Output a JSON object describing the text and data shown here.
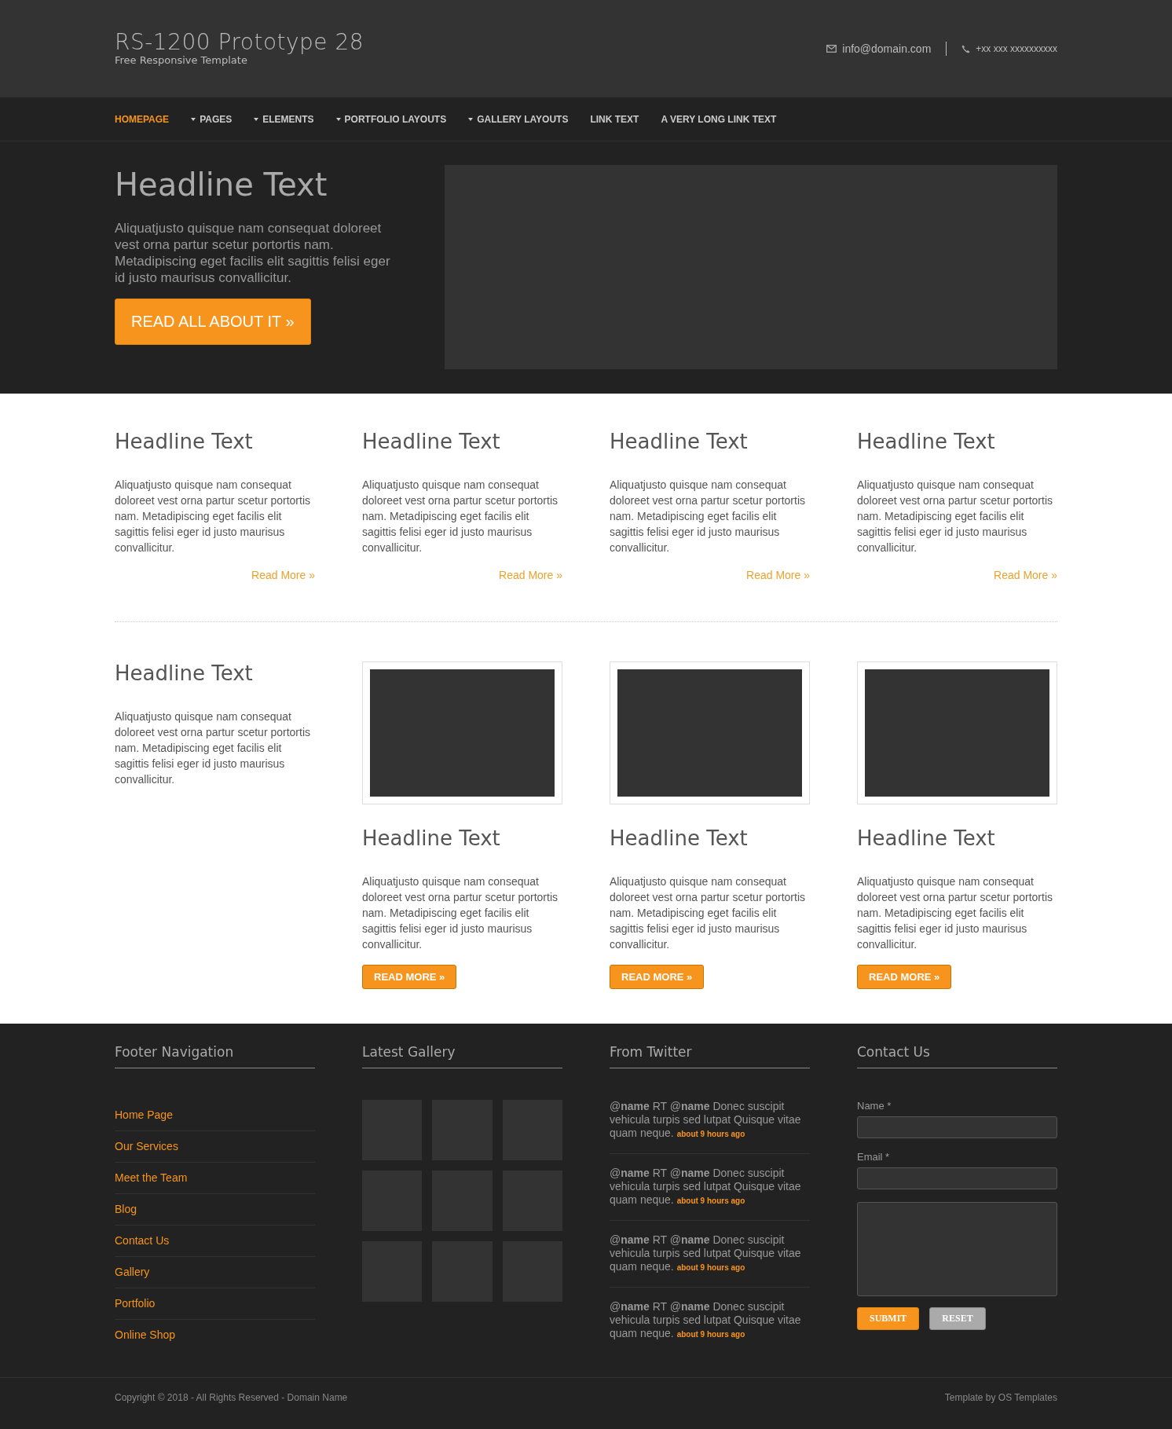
{
  "header": {
    "site_title": "RS-1200 Prototype 28",
    "tagline": "Free Responsive Template",
    "email": "info@domain.com",
    "phone": "+xx xxx xxxxxxxxxx"
  },
  "nav": [
    {
      "label": "HOMEPAGE",
      "selected": true,
      "dropdown": false
    },
    {
      "label": "PAGES",
      "selected": false,
      "dropdown": true
    },
    {
      "label": "ELEMENTS",
      "selected": false,
      "dropdown": true
    },
    {
      "label": "PORTFOLIO LAYOUTS",
      "selected": false,
      "dropdown": true
    },
    {
      "label": "GALLERY LAYOUTS",
      "selected": false,
      "dropdown": true
    },
    {
      "label": "LINK TEXT",
      "selected": false,
      "dropdown": false
    },
    {
      "label": "A VERY LONG LINK TEXT",
      "selected": false,
      "dropdown": false
    }
  ],
  "hero": {
    "headline": "Headline Text",
    "text": "Aliquatjusto quisque nam consequat doloreet vest orna partur scetur portortis nam. Metadipiscing eget facilis elit sagittis felisi eger id justo maurisus convallicitur.",
    "button": "READ ALL ABOUT IT »"
  },
  "features": [
    {
      "headline": "Headline Text",
      "text": "Aliquatjusto quisque nam consequat doloreet vest orna partur scetur portortis nam. Metadipiscing eget facilis elit sagittis felisi eger id justo maurisus convallicitur.",
      "link": "Read More »"
    },
    {
      "headline": "Headline Text",
      "text": "Aliquatjusto quisque nam consequat doloreet vest orna partur scetur portortis nam. Metadipiscing eget facilis elit sagittis felisi eger id justo maurisus convallicitur.",
      "link": "Read More »"
    },
    {
      "headline": "Headline Text",
      "text": "Aliquatjusto quisque nam consequat doloreet vest orna partur scetur portortis nam. Metadipiscing eget facilis elit sagittis felisi eger id justo maurisus convallicitur.",
      "link": "Read More »"
    },
    {
      "headline": "Headline Text",
      "text": "Aliquatjusto quisque nam consequat doloreet vest orna partur scetur portortis nam. Metadipiscing eget facilis elit sagittis felisi eger id justo maurisus convallicitur.",
      "link": "Read More »"
    }
  ],
  "intro": {
    "headline": "Headline Text",
    "text": "Aliquatjusto quisque nam consequat doloreet vest orna partur scetur portortis nam. Metadipiscing eget facilis elit sagittis felisi eger id justo maurisus convallicitur."
  },
  "cards": [
    {
      "headline": "Headline Text",
      "text": "Aliquatjusto quisque nam consequat doloreet vest orna partur scetur portortis nam. Metadipiscing eget facilis elit sagittis felisi eger id justo maurisus convallicitur.",
      "button": "READ MORE »"
    },
    {
      "headline": "Headline Text",
      "text": "Aliquatjusto quisque nam consequat doloreet vest orna partur scetur portortis nam. Metadipiscing eget facilis elit sagittis felisi eger id justo maurisus convallicitur.",
      "button": "READ MORE »"
    },
    {
      "headline": "Headline Text",
      "text": "Aliquatjusto quisque nam consequat doloreet vest orna partur scetur portortis nam. Metadipiscing eget facilis elit sagittis felisi eger id justo maurisus convallicitur.",
      "button": "READ MORE »"
    }
  ],
  "footer": {
    "nav_title": "Footer Navigation",
    "nav_links": [
      "Home Page",
      "Our Services",
      "Meet the Team",
      "Blog",
      "Contact Us",
      "Gallery",
      "Portfolio",
      "Online Shop"
    ],
    "gallery_title": "Latest Gallery",
    "twitter_title": "From Twitter",
    "tweets": [
      {
        "text": "@**name** RT @**name** Donec suscipit vehicula turpis sed lutpat Quisque vitae quam neque.",
        "time": "about 9 hours ago"
      },
      {
        "text": "@**name** RT @**name** Donec suscipit vehicula turpis sed lutpat Quisque vitae quam neque.",
        "time": "about 9 hours ago"
      },
      {
        "text": "@**name** RT @**name** Donec suscipit vehicula turpis sed lutpat Quisque vitae quam neque.",
        "time": "about 9 hours ago"
      },
      {
        "text": "@**name** RT @**name** Donec suscipit vehicula turpis sed lutpat Quisque vitae quam neque.",
        "time": "about 9 hours ago"
      }
    ],
    "contact_title": "Contact Us",
    "name_label": "Name *",
    "email_label": "Email *",
    "submit": "SUBMIT",
    "reset": "RESET"
  },
  "bottom": {
    "copyright": "Copyright © 2018 - All Rights Reserved - Domain Name",
    "credit": "Template by OS Templates"
  }
}
